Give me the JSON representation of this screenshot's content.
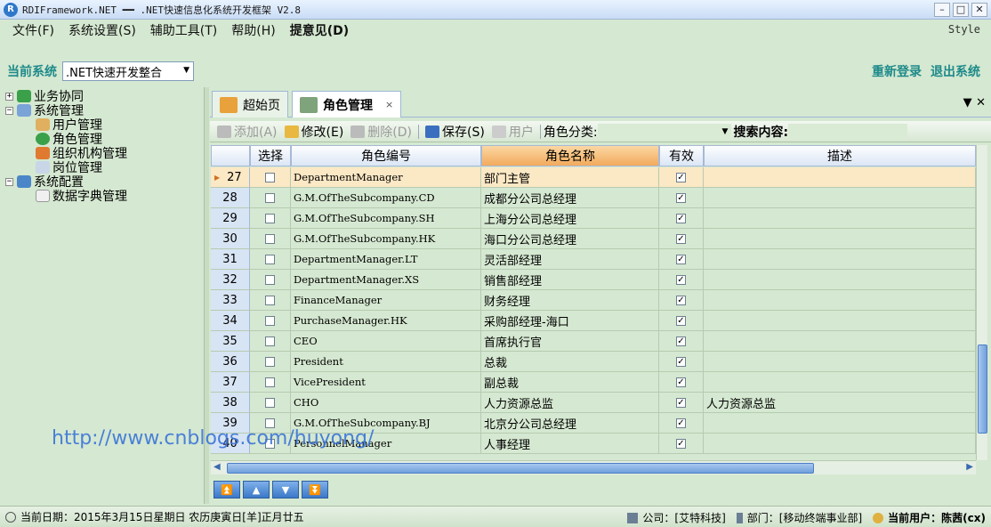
{
  "window": {
    "title": "RDIFramework.NET ━━ .NET快速信息化系统开发框架 V2.8",
    "app_icon": "R"
  },
  "menu": {
    "items": [
      "文件(F)",
      "系统设置(S)",
      "辅助工具(T)",
      "帮助(H)",
      "提意见(D)"
    ],
    "style_label": "Style"
  },
  "system_bar": {
    "label": "当前系统",
    "selected": ".NET快速开发整合",
    "relogin": "重新登录",
    "exit": "退出系统"
  },
  "tree": [
    {
      "label": "业务协同",
      "level": 0,
      "expander": "+"
    },
    {
      "label": "系统管理",
      "level": 0,
      "expander": "−"
    },
    {
      "label": "用户管理",
      "level": 1
    },
    {
      "label": "角色管理",
      "level": 1
    },
    {
      "label": "组织机构管理",
      "level": 1
    },
    {
      "label": "岗位管理",
      "level": 1
    },
    {
      "label": "系统配置",
      "level": 0,
      "expander": "−"
    },
    {
      "label": "数据字典管理",
      "level": 1
    }
  ],
  "tabs": [
    {
      "label": "超始页"
    },
    {
      "label": "角色管理",
      "close": "×"
    }
  ],
  "tab_controls": "▼ ✕",
  "toolbar": {
    "add": "添加(A)",
    "edit": "修改(E)",
    "delete": "删除(D)",
    "save": "保存(S)",
    "user": "用户",
    "category_label": "角色分类:",
    "search_label": "搜索内容:"
  },
  "grid": {
    "columns": [
      "",
      "选择",
      "角色编号",
      "角色名称",
      "有效",
      "描述"
    ],
    "rows": [
      {
        "no": "27",
        "code": "DepartmentManager",
        "name": "部门主管",
        "valid": "✓",
        "desc": ""
      },
      {
        "no": "28",
        "code": "G.M.OfTheSubcompany.CD",
        "name": "成都分公司总经理",
        "valid": "✓",
        "desc": ""
      },
      {
        "no": "29",
        "code": "G.M.OfTheSubcompany.SH",
        "name": "上海分公司总经理",
        "valid": "✓",
        "desc": ""
      },
      {
        "no": "30",
        "code": "G.M.OfTheSubcompany.HK",
        "name": "海口分公司总经理",
        "valid": "✓",
        "desc": ""
      },
      {
        "no": "31",
        "code": "DepartmentManager.LT",
        "name": "灵活部经理",
        "valid": "✓",
        "desc": ""
      },
      {
        "no": "32",
        "code": "DepartmentManager.XS",
        "name": "销售部经理",
        "valid": "✓",
        "desc": ""
      },
      {
        "no": "33",
        "code": "FinanceManager",
        "name": "财务经理",
        "valid": "✓",
        "desc": ""
      },
      {
        "no": "34",
        "code": "PurchaseManager.HK",
        "name": "采购部经理-海口",
        "valid": "✓",
        "desc": ""
      },
      {
        "no": "35",
        "code": "CEO",
        "name": "首席执行官",
        "valid": "✓",
        "desc": ""
      },
      {
        "no": "36",
        "code": "President",
        "name": "总裁",
        "valid": "✓",
        "desc": ""
      },
      {
        "no": "37",
        "code": "VicePresident",
        "name": "副总裁",
        "valid": "✓",
        "desc": ""
      },
      {
        "no": "38",
        "code": "CHO",
        "name": "人力资源总监",
        "valid": "✓",
        "desc": "人力资源总监"
      },
      {
        "no": "39",
        "code": "G.M.OfTheSubcompany.BJ",
        "name": "北京分公司总经理",
        "valid": "✓",
        "desc": ""
      },
      {
        "no": "40",
        "code": "PersonnelManager",
        "name": "人事经理",
        "valid": "✓",
        "desc": ""
      }
    ]
  },
  "nav_buttons": [
    "⏫",
    "▲",
    "▼",
    "⏬"
  ],
  "watermark": "http://www.cnblogs.com/huyong/",
  "status": {
    "date": "当前日期：2015年3月15日星期日 农历庚寅日[羊]正月廿五",
    "company": "公司：[艾特科技]",
    "department": "部门：[移动终端事业部]",
    "user": "当前用户：陈茜(cx)"
  }
}
